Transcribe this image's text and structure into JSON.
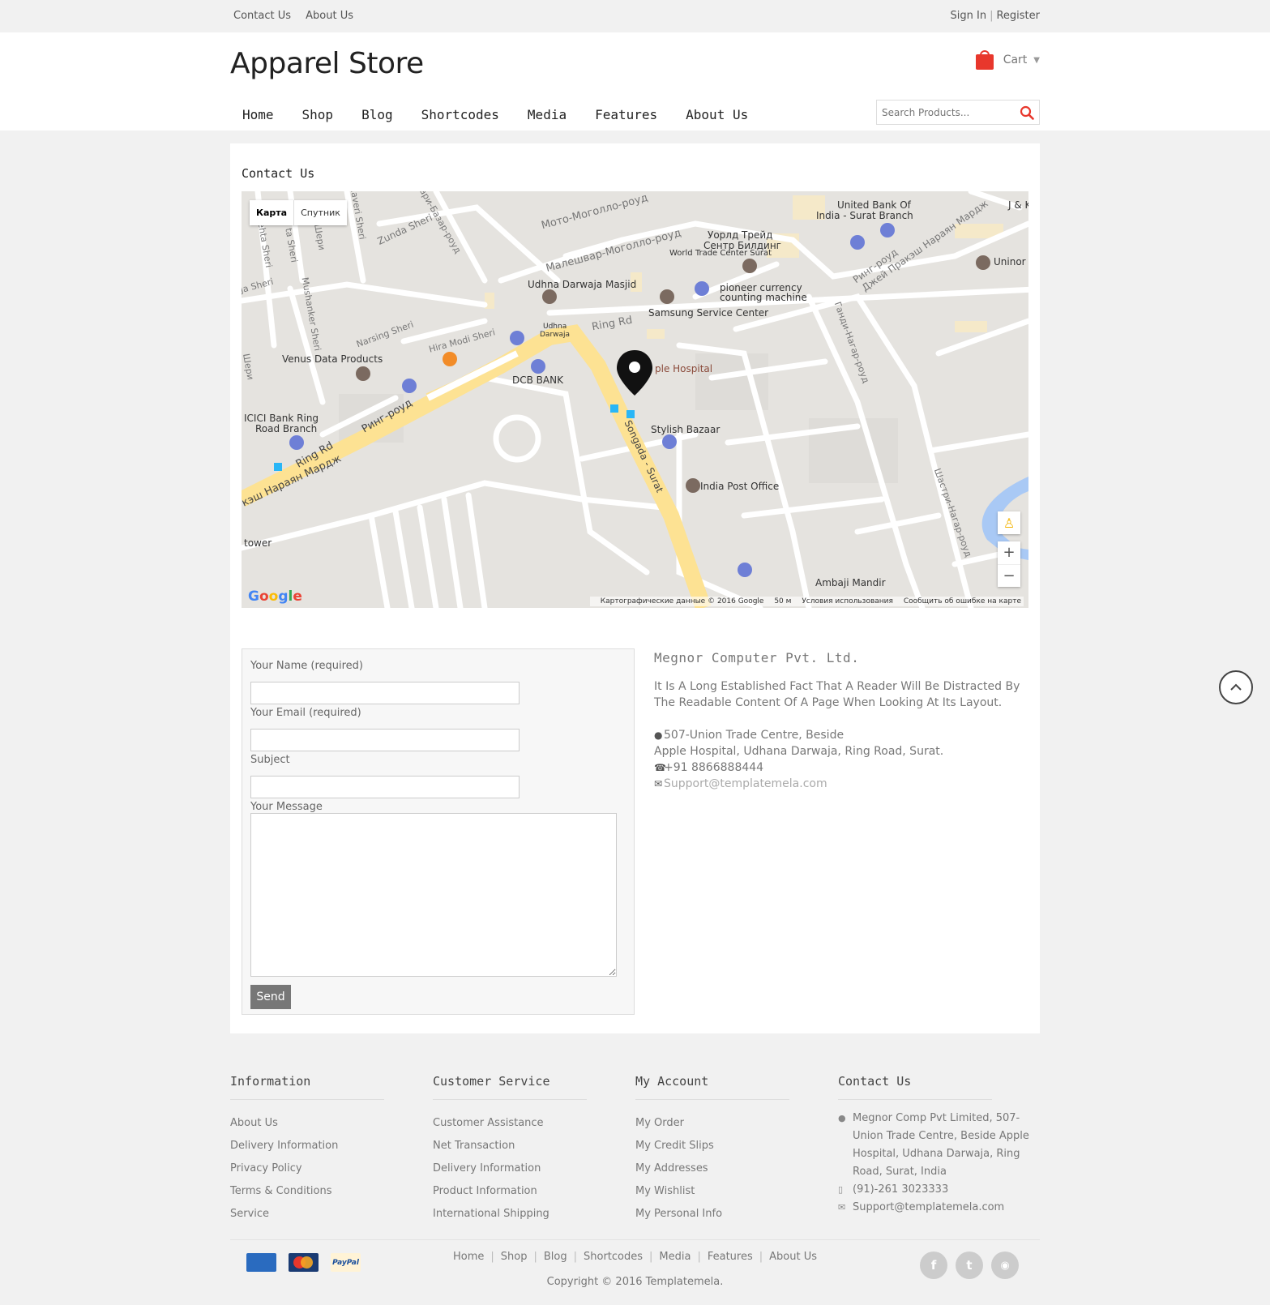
{
  "topbar": {
    "left_links": [
      "Contact Us",
      "About Us"
    ],
    "sign_in": "Sign In",
    "separator": "|",
    "register": "Register"
  },
  "header": {
    "logo": "Apparel Store",
    "cart_label": "Cart",
    "search_placeholder": "Search Products...",
    "nav": [
      "Home",
      "Shop",
      "Blog",
      "Shortcodes",
      "Media",
      "Features",
      "About Us"
    ]
  },
  "page": {
    "title": "Contact Us"
  },
  "map": {
    "type_map": "Карта",
    "type_satellite": "Спутник",
    "google": "Google",
    "attribution": "Картографические данные © 2016 Google",
    "scale": "50 м",
    "terms": "Условия использования",
    "report": "Сообщить об ошибке на карте",
    "zoom_in": "+",
    "zoom_out": "−",
    "labels": {
      "moto": "Мото-Моголло-роуд",
      "malesh": "Малешвар-Моголло-роуд",
      "world_trade": "Уорлд Трейд",
      "world_trade2": "Сентр Билдинг",
      "world_trade3": "World Trade Center Surat",
      "union_bank": "United Bank Of",
      "union_bank2": "India - Surat Branch",
      "jk": "J & K",
      "uninor": "Uninor",
      "masjid": "Udhna Darwaja Masjid",
      "pioneer": "pioneer currency",
      "pioneer2": "counting machine",
      "samsung": "Samsung Service Center",
      "ring_rd": "Ring Rd",
      "udhna": "Udhna",
      "darwaja": "Darwaja",
      "hira": "Hira Modi Sheri",
      "narsing": "Narsing Sheri",
      "venus": "Venus Data Products",
      "hospital": "ple Hospital",
      "dcb": "DCB BANK",
      "icici": "ICICI Bank Ring",
      "icici2": "Road Branch",
      "ring_road_ru": "Ринг-роуд",
      "ring_rd2": "Ring Rd",
      "praka": "кэш Нараян Мардж",
      "stylish": "Stylish Bazaar",
      "songada": "Songada - Surat",
      "post": "India Post Office",
      "tower": "tower",
      "ambaji": "Ambaji Mandir",
      "zunda": "Zunda Sheri",
      "gandhi": "Ганди-Нагар-роуд",
      "shastri": "Шастри-Нагар-роуд",
      "ring_road_ru2": "Ринг-роуд",
      "praka2": "Джей Пракэш Нараян Мардж",
      "bazar": "ари-Базар-роуд",
      "mehta": "Mehta Sheri",
      "zaveri": "Zaveri Sheri",
      "la_sheri": "la Sheri",
      "musha": "Mushanker Sheri",
      "ja_sheri": "Ja Sheri",
      "sheri_left": "Шери",
      "sheri_top": "Шери",
      "ta_sheri": "ta Sheri"
    }
  },
  "form": {
    "name_label": "Your Name (required)",
    "email_label": "Your Email (required)",
    "subject_label": "Subject",
    "message_label": "Your Message",
    "send": "Send"
  },
  "company": {
    "name": "Megnor Computer Pvt. Ltd.",
    "description": "It Is A Long Established Fact That A Reader Will Be Distracted By The Readable Content Of A Page When Looking At Its Layout.",
    "address_line1": "507-Union Trade Centre, Beside",
    "address_line2": "Apple Hospital, Udhana Darwaja, Ring Road, Surat.",
    "phone": "+91 8866888444",
    "email": "Support@templatemela.com"
  },
  "footer": {
    "information": {
      "title": "Information",
      "items": [
        "About Us",
        "Delivery Information",
        "Privacy Policy",
        "Terms & Conditions",
        "Service"
      ]
    },
    "customer_service": {
      "title": "Customer Service",
      "items": [
        "Customer Assistance",
        "Net Transaction",
        "Delivery Information",
        "Product Information",
        "International Shipping"
      ]
    },
    "my_account": {
      "title": "My Account",
      "items": [
        "My Order",
        "My Credit Slips",
        "My Addresses",
        "My Wishlist",
        "My Personal Info"
      ]
    },
    "contact": {
      "title": "Contact Us",
      "address": "Megnor Comp Pvt Limited, 507-Union Trade Centre, Beside Apple Hospital, Udhana Darwaja, Ring Road, Surat, India",
      "phone": "(91)-261 3023333",
      "email": "Support@templatemela.com"
    },
    "payments": [
      "AMERICAN EXPRESS",
      "MasterCard",
      "PayPal"
    ],
    "nav": [
      "Home",
      "Shop",
      "Blog",
      "Shortcodes",
      "Media",
      "Features",
      "About Us"
    ],
    "separator": "|",
    "copyright": "Copyright © 2016 Templatemela.",
    "social": [
      "f",
      "t",
      "rss"
    ]
  },
  "colors": {
    "accent": "#e8372c",
    "road_major": "#fde293",
    "map_bg": "#e5e3df",
    "water": "#a9c9f5"
  },
  "icons": {
    "cart": "shopping-bag-icon",
    "search": "search-icon",
    "marker": "map-marker-icon",
    "phone": "phone-icon",
    "mail": "envelope-icon",
    "back_to_top": "chevron-up-icon"
  }
}
